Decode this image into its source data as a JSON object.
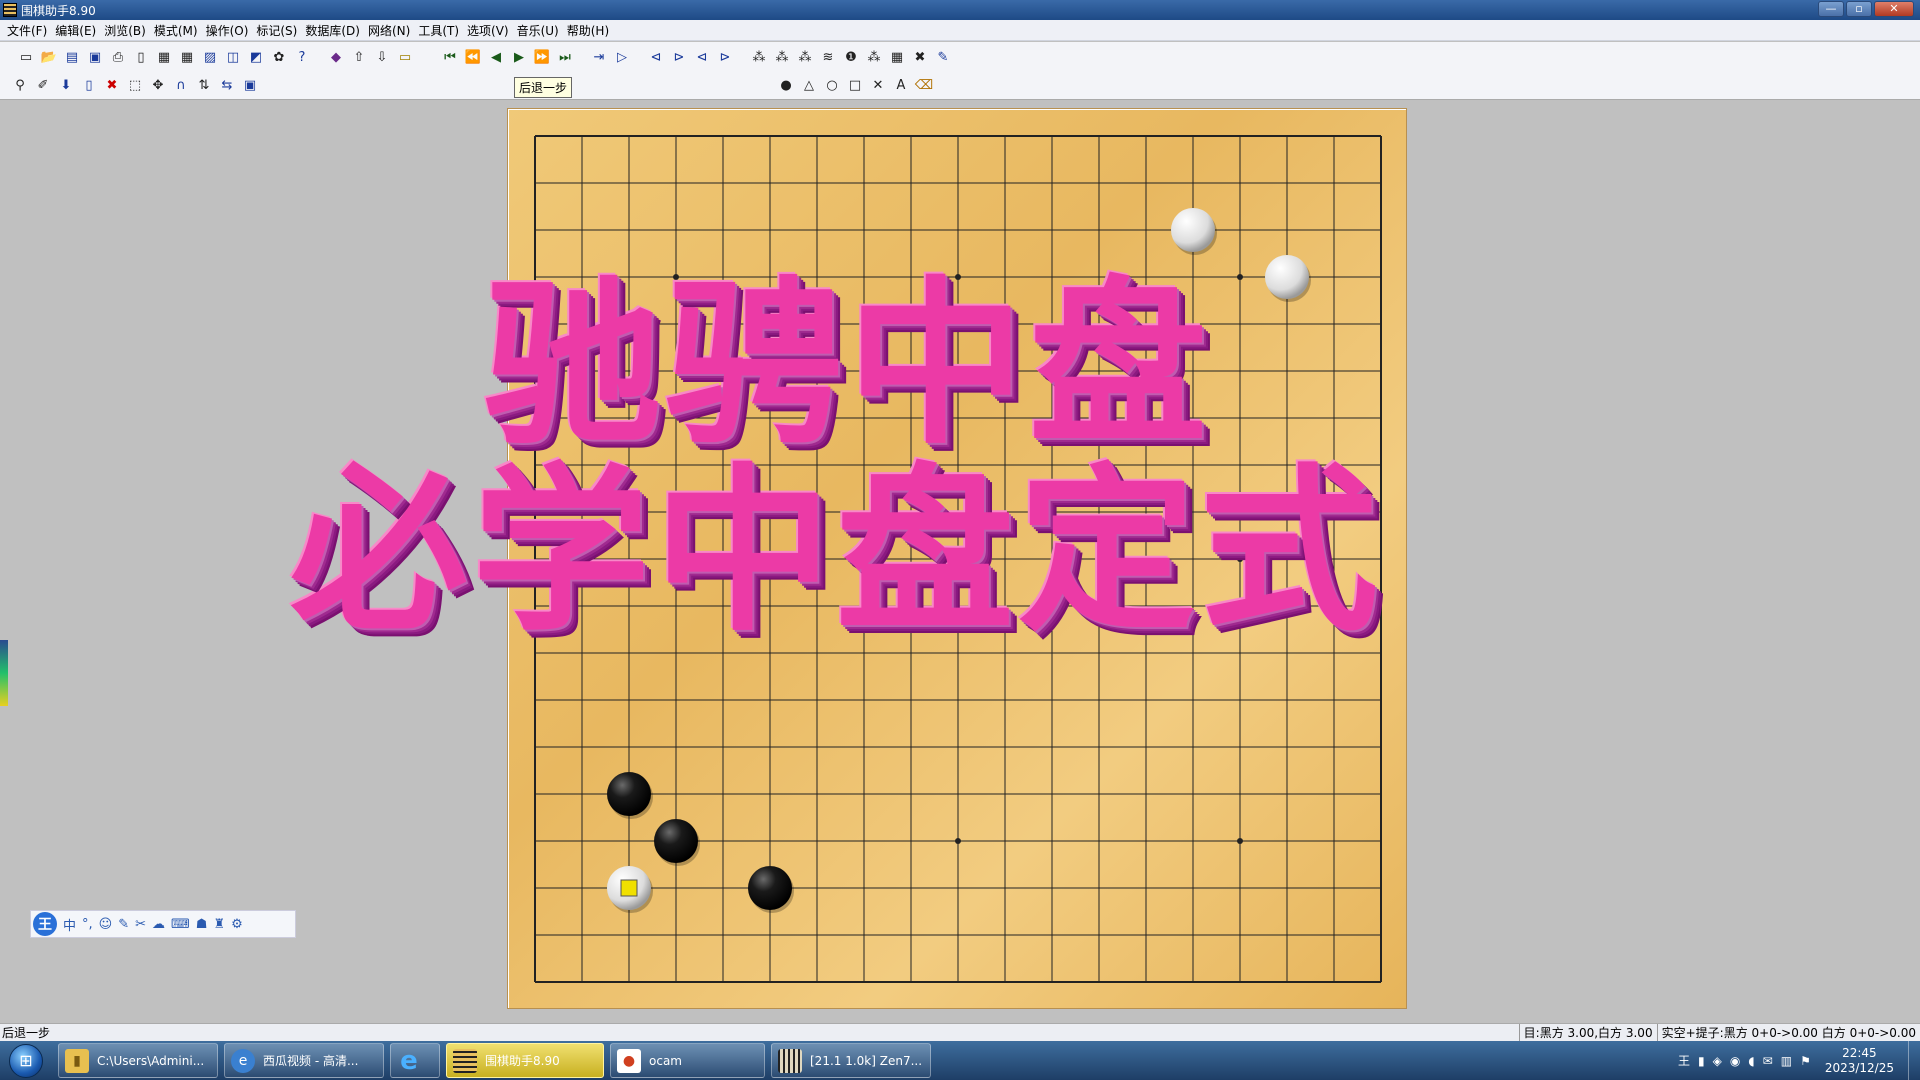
{
  "window": {
    "title": "围棋助手8.90",
    "minimize": "—",
    "maximize": "▫",
    "close": "✕"
  },
  "menu": [
    "文件(F)",
    "编辑(E)",
    "浏览(B)",
    "模式(M)",
    "操作(O)",
    "标记(S)",
    "数据库(D)",
    "网络(N)",
    "工具(T)",
    "选项(V)",
    "音乐(U)",
    "帮助(H)"
  ],
  "toolbar": {
    "tooltip": "后退一步"
  },
  "board": {
    "size": 19,
    "star_points": [
      [
        3,
        3
      ],
      [
        3,
        9
      ],
      [
        3,
        15
      ],
      [
        9,
        3
      ],
      [
        9,
        9
      ],
      [
        9,
        15
      ],
      [
        15,
        3
      ],
      [
        15,
        9
      ],
      [
        15,
        15
      ]
    ],
    "stones": [
      {
        "color": "white",
        "col": 14,
        "row": 2
      },
      {
        "color": "white",
        "col": 16,
        "row": 3
      },
      {
        "color": "black",
        "col": 2,
        "row": 14
      },
      {
        "color": "black",
        "col": 3,
        "row": 15
      },
      {
        "color": "black",
        "col": 5,
        "row": 16
      },
      {
        "color": "white",
        "col": 2,
        "row": 16,
        "last_move": true
      }
    ]
  },
  "overlay": {
    "line1": "驰骋中盘",
    "line2": "必学中盘定式"
  },
  "ime": {
    "logo": "王",
    "mode": "中"
  },
  "status": {
    "left": "后退一步",
    "score": "目:黑方 3.00,白方 3.00",
    "capture": "实空+提子:黑方 0+0->0.00 白方 0+0->0.00"
  },
  "taskbar": {
    "start_label": "⊞",
    "items": [
      {
        "label": "C:\\Users\\Admini...",
        "icon": "folder-icon"
      },
      {
        "label": "西瓜视频 - 高清...",
        "icon": "browser-icon"
      },
      {
        "label": "",
        "icon": "ie-icon"
      },
      {
        "label": "围棋助手8.90",
        "icon": "go-board-icon",
        "active": true
      },
      {
        "label": "ocam",
        "icon": "ocam-icon"
      },
      {
        "label": "[21.1 1.0k] Zen7...",
        "icon": "zen-icon"
      }
    ],
    "time": "22:45",
    "date": "2023/12/25"
  },
  "colors": {
    "board": "#e8b860",
    "overlay_text": "#ec3aa6",
    "last_move_marker": "#f0e000"
  }
}
